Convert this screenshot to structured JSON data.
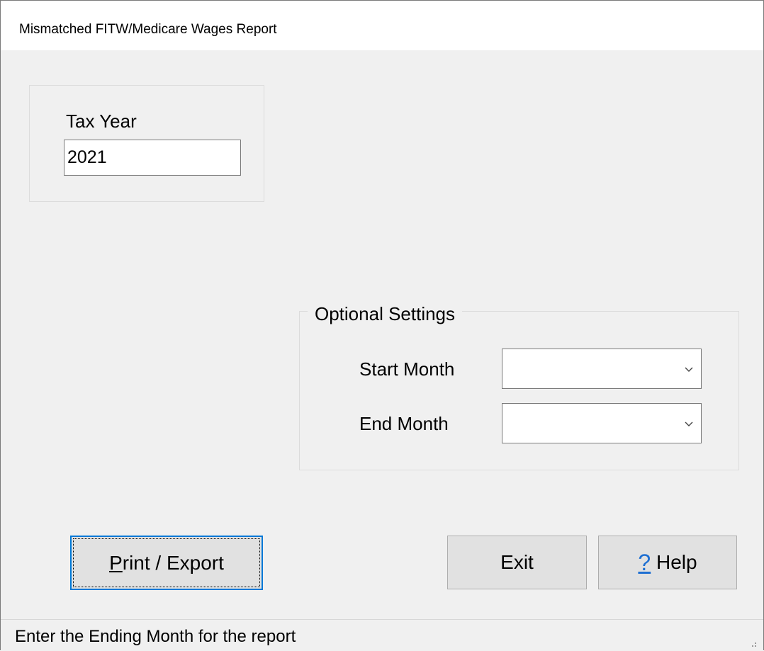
{
  "window": {
    "title": "Mismatched FITW/Medicare Wages Report"
  },
  "tax_year": {
    "label": "Tax Year",
    "value": "2021"
  },
  "optional_settings": {
    "legend": "Optional Settings",
    "start_month": {
      "label": "Start Month",
      "value": ""
    },
    "end_month": {
      "label": "End Month",
      "value": ""
    }
  },
  "buttons": {
    "print_export": {
      "mnemonic": "P",
      "rest": "rint / Export"
    },
    "exit": "Exit",
    "help": {
      "icon": "question-mark-icon",
      "mnemonic": "?",
      "label": " Help"
    }
  },
  "status": {
    "text": "Enter the Ending Month for the report"
  },
  "colors": {
    "window_bg": "#f0f0f0",
    "button_bg": "#e1e1e1",
    "focus_accent": "#0078d7",
    "help_icon": "#1e6fd2"
  }
}
